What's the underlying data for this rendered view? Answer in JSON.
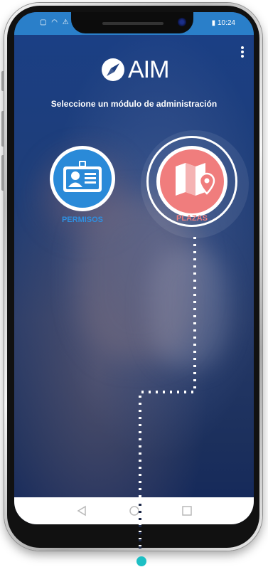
{
  "status_bar": {
    "time": "10:24"
  },
  "header": {
    "app_name": "AIM"
  },
  "subtitle": "Seleccione un módulo de administración",
  "modules": [
    {
      "label": "PERMISOS",
      "icon": "id-card-icon",
      "color": "#2a8ad8"
    },
    {
      "label": "PLAZAS",
      "icon": "map-pin-icon",
      "color": "#f07d7d"
    }
  ],
  "colors": {
    "accent_teal": "#1dbfc4",
    "status_bar": "#2a7fc9"
  }
}
